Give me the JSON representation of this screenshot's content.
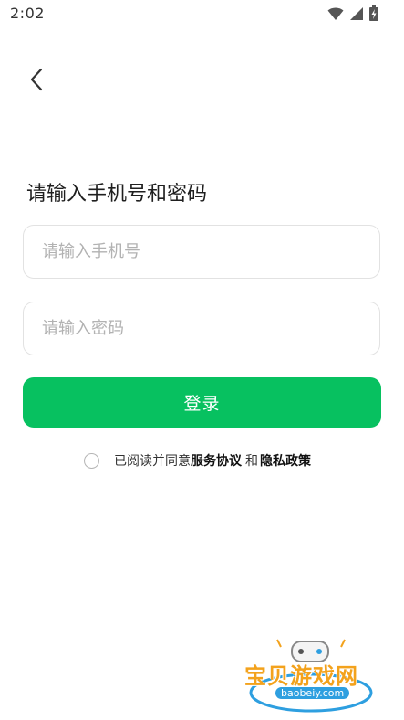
{
  "status_bar": {
    "time": "2:02",
    "icons": [
      "wifi-icon",
      "signal-icon",
      "battery-charging-icon"
    ]
  },
  "nav": {
    "back_icon": "chevron-left-icon"
  },
  "heading": "请输入手机号和密码",
  "phone_field": {
    "placeholder": "请输入手机号",
    "value": ""
  },
  "password_field": {
    "placeholder": "请输入密码",
    "value": ""
  },
  "login_button": {
    "label": "登录"
  },
  "agreement": {
    "prefix": "已阅读并同意",
    "service_link": "服务协议",
    "connector": "和",
    "privacy_link": "隐私政策",
    "checked": false
  },
  "watermark": {
    "text": "宝贝游戏网",
    "domain": "baobeiy.com"
  },
  "colors": {
    "primary": "#07c160",
    "placeholder": "#b2b2b2",
    "border": "#e2e2e2"
  }
}
